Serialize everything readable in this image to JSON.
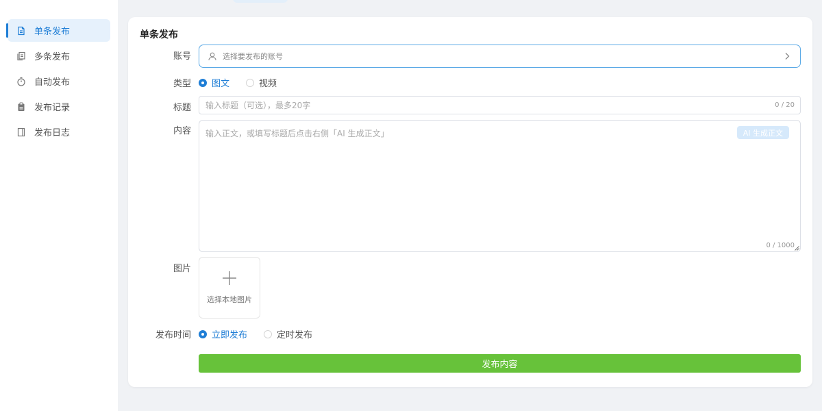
{
  "sidebar": {
    "items": [
      {
        "label": "单条发布",
        "icon": "document-icon",
        "active": true
      },
      {
        "label": "多条发布",
        "icon": "documents-icon",
        "active": false
      },
      {
        "label": "自动发布",
        "icon": "timer-icon",
        "active": false
      },
      {
        "label": "发布记录",
        "icon": "clipboard-icon",
        "active": false
      },
      {
        "label": "发布日志",
        "icon": "notebook-icon",
        "active": false
      }
    ]
  },
  "form": {
    "title": "单条发布",
    "account": {
      "label": "账号",
      "placeholder": "选择要发布的账号"
    },
    "type": {
      "label": "类型",
      "options": [
        {
          "label": "图文",
          "checked": true
        },
        {
          "label": "视频",
          "checked": false
        }
      ]
    },
    "title_field": {
      "label": "标题",
      "placeholder": "输入标题（可选），最多20字",
      "count": "0 / 20"
    },
    "content": {
      "label": "内容",
      "placeholder": "输入正文，或填写标题后点击右侧「AI 生成正文」",
      "ai_button": "AI 生成正文",
      "count": "0 / 1000"
    },
    "image": {
      "label": "图片",
      "upload_label": "选择本地图片"
    },
    "publish_time": {
      "label": "发布时间",
      "options": [
        {
          "label": "立即发布",
          "checked": true
        },
        {
          "label": "定时发布",
          "checked": false
        }
      ]
    },
    "submit_label": "发布内容"
  },
  "colors": {
    "accent": "#1f7ed6",
    "submit": "#67c23a",
    "active_bg": "#e6f1fc"
  }
}
